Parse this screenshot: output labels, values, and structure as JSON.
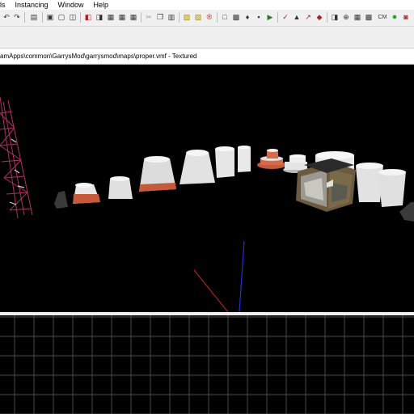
{
  "menu": {
    "items": [
      {
        "label": "ls"
      },
      {
        "label": "Instancing"
      },
      {
        "label": "Window"
      },
      {
        "label": "Help"
      }
    ]
  },
  "toolbar": {
    "buttons": [
      {
        "name": "undo-icon",
        "glyph": "↶"
      },
      {
        "name": "redo-icon",
        "glyph": "↷"
      },
      {
        "name": "compile-icon",
        "glyph": "▤"
      },
      {
        "name": "group-icon",
        "glyph": "▣"
      },
      {
        "name": "ungroup-icon",
        "glyph": "▢"
      },
      {
        "name": "hide-icon",
        "glyph": "◫"
      },
      {
        "name": "carve-icon",
        "glyph": "◧"
      },
      {
        "name": "clip-icon",
        "glyph": "◨"
      },
      {
        "name": "hollow-icon",
        "glyph": "▦"
      },
      {
        "name": "cut-icon",
        "glyph": "✂"
      },
      {
        "name": "copy-icon",
        "glyph": "❐"
      },
      {
        "name": "paste-icon",
        "glyph": "▥"
      },
      {
        "name": "texture-lock-icon",
        "glyph": "▧"
      },
      {
        "name": "texture-scale-icon",
        "glyph": "▨"
      },
      {
        "name": "radius-icon",
        "glyph": "®"
      },
      {
        "name": "selection-box-icon",
        "glyph": "□"
      },
      {
        "name": "entity-icon",
        "glyph": "▩"
      },
      {
        "name": "decal-icon",
        "glyph": "♦"
      },
      {
        "name": "overlay-icon",
        "glyph": "▪"
      },
      {
        "name": "run-map-icon",
        "glyph": "▶"
      },
      {
        "name": "check-icon",
        "glyph": "✓"
      },
      {
        "name": "displacement-icon",
        "glyph": "▲"
      },
      {
        "name": "path-icon",
        "glyph": "↗"
      },
      {
        "name": "model-icon",
        "glyph": "◆"
      },
      {
        "name": "cordon-icon",
        "glyph": "⊕"
      },
      {
        "name": "grid-icon",
        "glyph": "▦"
      },
      {
        "name": "cm-label",
        "glyph": "CM"
      },
      {
        "name": "green-leaf-icon",
        "glyph": "●"
      },
      {
        "name": "no-draw-icon",
        "glyph": "◙"
      }
    ]
  },
  "document": {
    "title": "amApps\\common\\GarrysMod\\garrysmod\\maps\\proper.vmf - Textured"
  },
  "colors": {
    "ui_background": "#f0f0f0",
    "viewport_background": "#000000",
    "grid_line": "#4a4a4a",
    "accent_red": "#cc2a2a",
    "axis_blue": "#2233cc",
    "axis_red": "#cc2222"
  }
}
